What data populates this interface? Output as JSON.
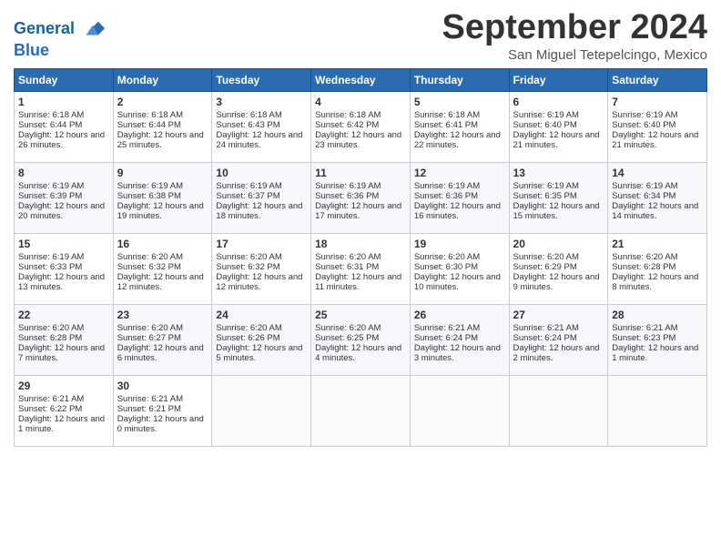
{
  "header": {
    "logo_line1": "General",
    "logo_line2": "Blue",
    "month_title": "September 2024",
    "subtitle": "San Miguel Tetepelcingo, Mexico"
  },
  "weekdays": [
    "Sunday",
    "Monday",
    "Tuesday",
    "Wednesday",
    "Thursday",
    "Friday",
    "Saturday"
  ],
  "weeks": [
    [
      {
        "day": "1",
        "sunrise": "6:18 AM",
        "sunset": "6:44 PM",
        "daylight": "12 hours and 26 minutes."
      },
      {
        "day": "2",
        "sunrise": "6:18 AM",
        "sunset": "6:44 PM",
        "daylight": "12 hours and 25 minutes."
      },
      {
        "day": "3",
        "sunrise": "6:18 AM",
        "sunset": "6:43 PM",
        "daylight": "12 hours and 24 minutes."
      },
      {
        "day": "4",
        "sunrise": "6:18 AM",
        "sunset": "6:42 PM",
        "daylight": "12 hours and 23 minutes."
      },
      {
        "day": "5",
        "sunrise": "6:18 AM",
        "sunset": "6:41 PM",
        "daylight": "12 hours and 22 minutes."
      },
      {
        "day": "6",
        "sunrise": "6:19 AM",
        "sunset": "6:40 PM",
        "daylight": "12 hours and 21 minutes."
      },
      {
        "day": "7",
        "sunrise": "6:19 AM",
        "sunset": "6:40 PM",
        "daylight": "12 hours and 21 minutes."
      }
    ],
    [
      {
        "day": "8",
        "sunrise": "6:19 AM",
        "sunset": "6:39 PM",
        "daylight": "12 hours and 20 minutes."
      },
      {
        "day": "9",
        "sunrise": "6:19 AM",
        "sunset": "6:38 PM",
        "daylight": "12 hours and 19 minutes."
      },
      {
        "day": "10",
        "sunrise": "6:19 AM",
        "sunset": "6:37 PM",
        "daylight": "12 hours and 18 minutes."
      },
      {
        "day": "11",
        "sunrise": "6:19 AM",
        "sunset": "6:36 PM",
        "daylight": "12 hours and 17 minutes."
      },
      {
        "day": "12",
        "sunrise": "6:19 AM",
        "sunset": "6:36 PM",
        "daylight": "12 hours and 16 minutes."
      },
      {
        "day": "13",
        "sunrise": "6:19 AM",
        "sunset": "6:35 PM",
        "daylight": "12 hours and 15 minutes."
      },
      {
        "day": "14",
        "sunrise": "6:19 AM",
        "sunset": "6:34 PM",
        "daylight": "12 hours and 14 minutes."
      }
    ],
    [
      {
        "day": "15",
        "sunrise": "6:19 AM",
        "sunset": "6:33 PM",
        "daylight": "12 hours and 13 minutes."
      },
      {
        "day": "16",
        "sunrise": "6:20 AM",
        "sunset": "6:32 PM",
        "daylight": "12 hours and 12 minutes."
      },
      {
        "day": "17",
        "sunrise": "6:20 AM",
        "sunset": "6:32 PM",
        "daylight": "12 hours and 12 minutes."
      },
      {
        "day": "18",
        "sunrise": "6:20 AM",
        "sunset": "6:31 PM",
        "daylight": "12 hours and 11 minutes."
      },
      {
        "day": "19",
        "sunrise": "6:20 AM",
        "sunset": "6:30 PM",
        "daylight": "12 hours and 10 minutes."
      },
      {
        "day": "20",
        "sunrise": "6:20 AM",
        "sunset": "6:29 PM",
        "daylight": "12 hours and 9 minutes."
      },
      {
        "day": "21",
        "sunrise": "6:20 AM",
        "sunset": "6:28 PM",
        "daylight": "12 hours and 8 minutes."
      }
    ],
    [
      {
        "day": "22",
        "sunrise": "6:20 AM",
        "sunset": "6:28 PM",
        "daylight": "12 hours and 7 minutes."
      },
      {
        "day": "23",
        "sunrise": "6:20 AM",
        "sunset": "6:27 PM",
        "daylight": "12 hours and 6 minutes."
      },
      {
        "day": "24",
        "sunrise": "6:20 AM",
        "sunset": "6:26 PM",
        "daylight": "12 hours and 5 minutes."
      },
      {
        "day": "25",
        "sunrise": "6:20 AM",
        "sunset": "6:25 PM",
        "daylight": "12 hours and 4 minutes."
      },
      {
        "day": "26",
        "sunrise": "6:21 AM",
        "sunset": "6:24 PM",
        "daylight": "12 hours and 3 minutes."
      },
      {
        "day": "27",
        "sunrise": "6:21 AM",
        "sunset": "6:24 PM",
        "daylight": "12 hours and 2 minutes."
      },
      {
        "day": "28",
        "sunrise": "6:21 AM",
        "sunset": "6:23 PM",
        "daylight": "12 hours and 1 minute."
      }
    ],
    [
      {
        "day": "29",
        "sunrise": "6:21 AM",
        "sunset": "6:22 PM",
        "daylight": "12 hours and 1 minute."
      },
      {
        "day": "30",
        "sunrise": "6:21 AM",
        "sunset": "6:21 PM",
        "daylight": "12 hours and 0 minutes."
      },
      null,
      null,
      null,
      null,
      null
    ]
  ]
}
